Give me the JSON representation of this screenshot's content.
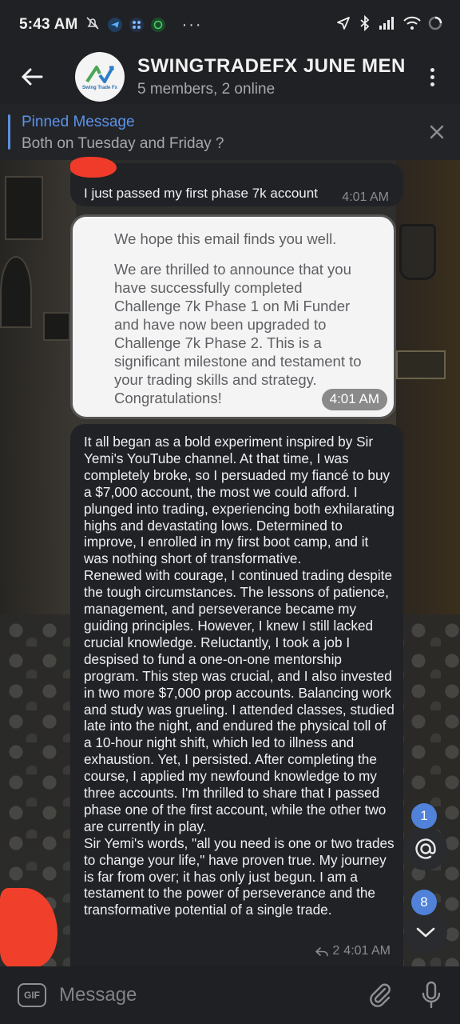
{
  "status_bar": {
    "time": "5:43 AM"
  },
  "header": {
    "title": "SWINGTRADEFX JUNE MEN",
    "subtitle": "5 members, 2 online",
    "avatar_text": "Swing Trade Fx"
  },
  "pinned": {
    "title": "Pinned Message",
    "text": "Both on Tuesday and Friday ?"
  },
  "messages": [
    {
      "text": "I just passed my first phase 7k account",
      "time": "4:01 AM"
    },
    {
      "paragraph1": "We hope this email finds you well.",
      "paragraph2": "We are thrilled to announce that you have successfully completed Challenge 7k Phase 1 on Mi Funder and have now been upgraded to Challenge 7k Phase 2. This is a significant milestone and testament to your trading skills and strategy. Congratulations!",
      "time": "4:01 AM"
    },
    {
      "text": "It all began as a bold experiment inspired by Sir Yemi's YouTube channel. At that time, I was completely broke, so I persuaded my fiancé to buy a $7,000 account, the most we could afford. I plunged into trading, experiencing both exhilarating highs and devastating lows. Determined to improve, I enrolled in my first boot camp, and it was nothing short of transformative.\nRenewed with courage, I continued trading despite the tough circumstances. The lessons of patience, management, and perseverance became my guiding principles. However, I knew I still lacked crucial knowledge. Reluctantly, I took a job I despised to fund a one-on-one mentorship program. This step was crucial, and I also invested in two more $7,000 prop accounts. Balancing work and study was grueling. I attended classes, studied late into the night, and endured the physical toll of a 10-hour night shift, which led to illness and exhaustion. Yet, I persisted. After completing the course, I applied my newfound knowledge to my three accounts. I'm thrilled to share that I passed phase one of the first account, while the other two are currently in play.\nSir Yemi's words, \"all you need is one or two trades to change your life,\" have proven true. My journey is far from over; it has only just begun. I am a testament to the power of perseverance and the transformative potential of a single trade.",
      "reply_count": "2",
      "time": "4:01 AM"
    }
  ],
  "floating": {
    "mentions_badge": "1",
    "scroll_down_badge": "8"
  },
  "composer": {
    "gif_label": "GIF",
    "placeholder": "Message"
  },
  "colors": {
    "accent": "#5b93ea",
    "badge": "#4f82d8",
    "bubble_dark": "#212226",
    "bubble_light": "#f4f4f5"
  }
}
